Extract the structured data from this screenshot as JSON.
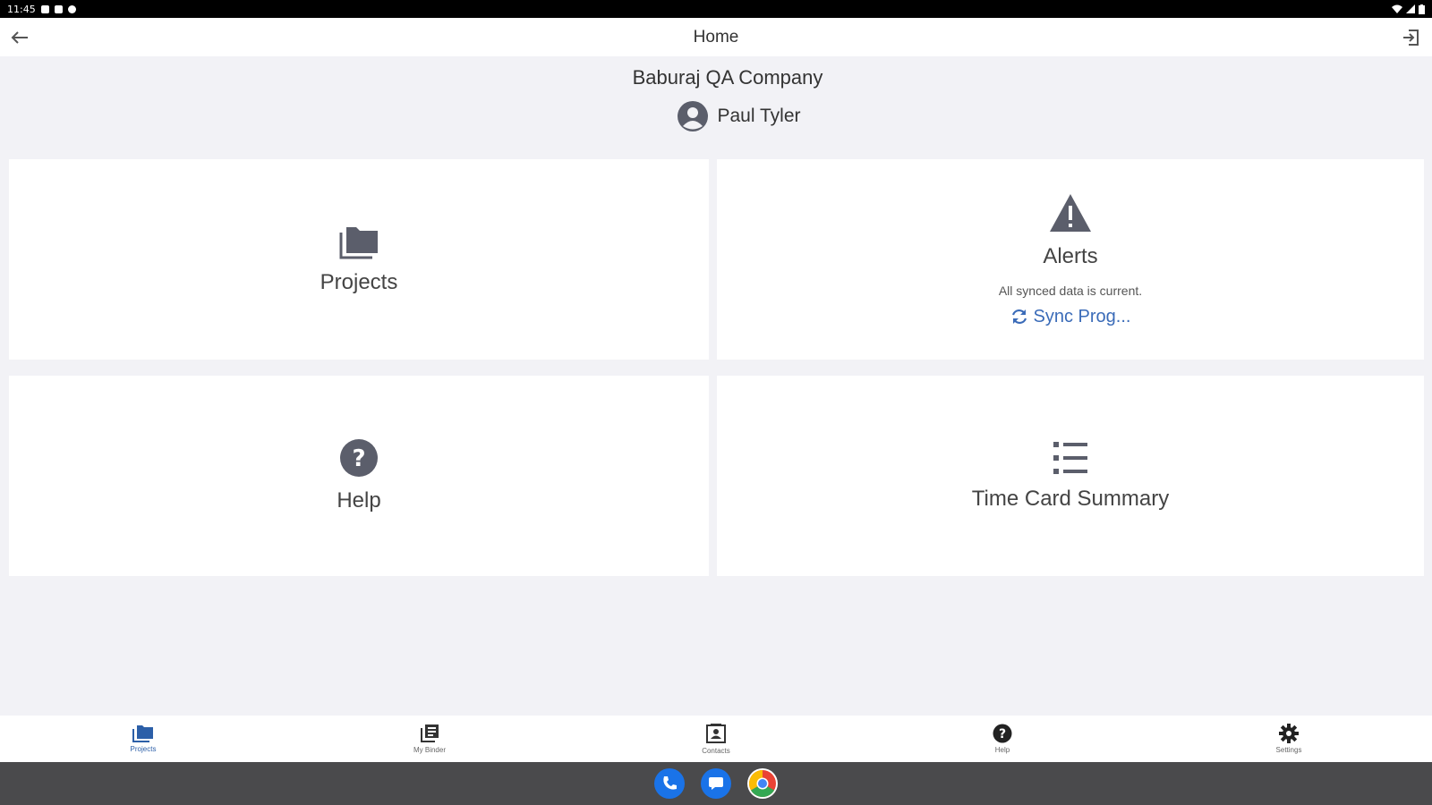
{
  "status_bar": {
    "time": "11:45"
  },
  "app_bar": {
    "title": "Home"
  },
  "company": "Baburaj QA Company",
  "user": {
    "name": "Paul Tyler"
  },
  "tiles": {
    "projects": {
      "label": "Projects"
    },
    "alerts": {
      "label": "Alerts",
      "status": "All synced data is current.",
      "sync_label": "Sync Prog..."
    },
    "help": {
      "label": "Help"
    },
    "timecard": {
      "label": "Time Card Summary"
    }
  },
  "tabs": [
    {
      "label": "Projects",
      "icon": "folder-icon"
    },
    {
      "label": "My Binder",
      "icon": "binder-icon"
    },
    {
      "label": "Contacts",
      "icon": "contacts-icon"
    },
    {
      "label": "Help",
      "icon": "help-icon"
    },
    {
      "label": "Settings",
      "icon": "gear-icon"
    }
  ],
  "colors": {
    "accent": "#2c5fa8",
    "sync": "#3a6bb8",
    "icon": "#5b5e6b",
    "background": "#f2f2f6"
  }
}
